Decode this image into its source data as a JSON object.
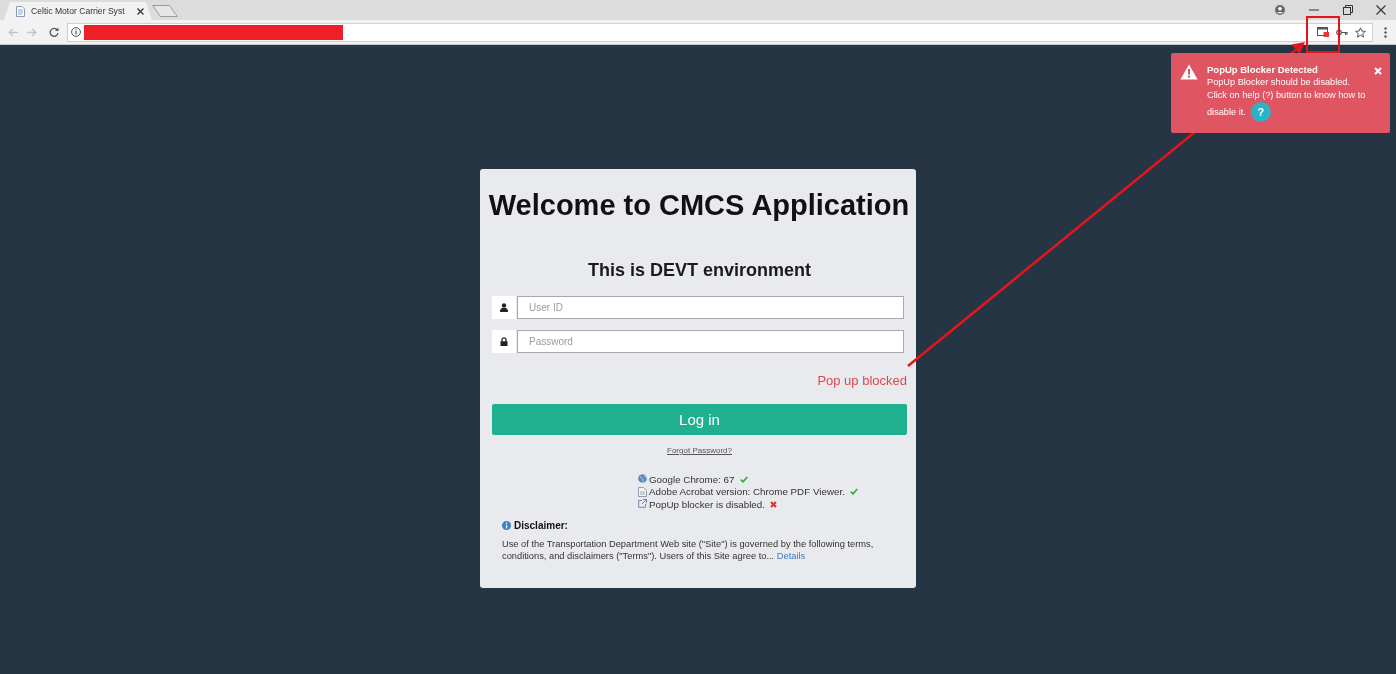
{
  "browser": {
    "tabs": [
      {
        "title": "Celtic Motor Carrier Syst",
        "selected": true
      }
    ]
  },
  "notification": {
    "title": "PopUp Blocker Detected",
    "lines": [
      "PopUp Blocker should be disabled.",
      "Click on help (?) button to know how to",
      "disable it."
    ],
    "help_label": "?"
  },
  "login": {
    "title": "Welcome to CMCS Application",
    "subtitle": "This is DEVT environment",
    "fields": [
      {
        "kind": "user",
        "placeholder": "User ID"
      },
      {
        "kind": "password",
        "placeholder": "Password"
      }
    ],
    "warning": "Pop up blocked",
    "button": "Log in",
    "forgot_link": "Forgot Password?",
    "checks": [
      {
        "kind": "browser",
        "text": "Google Chrome: 67",
        "passed": true
      },
      {
        "kind": "document",
        "text": "Adobe Acrobat version: Chrome PDF Viewer.",
        "passed": true
      },
      {
        "kind": "popup",
        "text": "PopUp blocker is disabled.",
        "passed": false
      }
    ],
    "disclaimer": {
      "heading": "Disclaimer:",
      "text": "Use of the Transportation Department Web site (\"Site\") is governed by the following terms, conditions, and disclaimers (\"Terms\"). Users of this Site agree to...",
      "link": "Details"
    }
  }
}
